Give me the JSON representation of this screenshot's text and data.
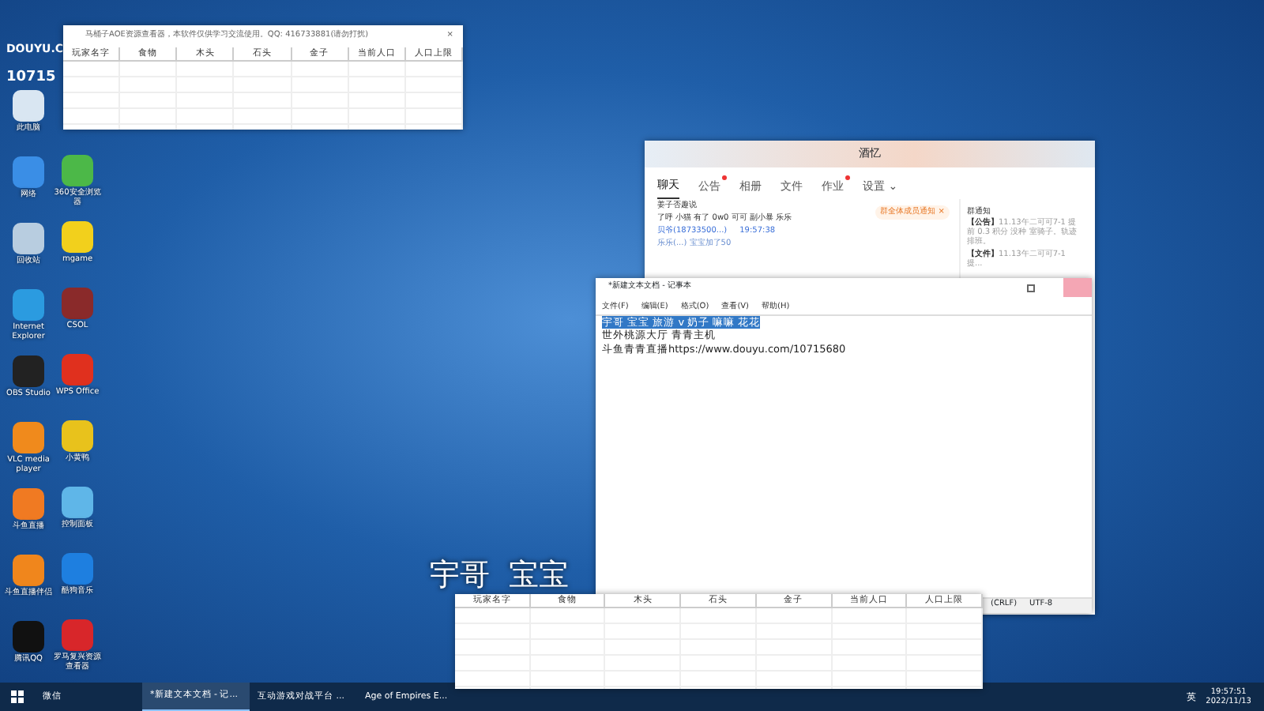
{
  "desktop_icons": {
    "left": [
      {
        "label": "此电脑",
        "color": "#d9e6f2"
      },
      {
        "label": "网络",
        "color": "#3a8ee6"
      },
      {
        "label": "回收站",
        "color": "#b8cde0"
      },
      {
        "label": "Internet Explorer",
        "color": "#2b9be0"
      },
      {
        "label": "OBS Studio",
        "color": "#222222"
      },
      {
        "label": "VLC media player",
        "color": "#f08a1c"
      },
      {
        "label": "斗鱼直播",
        "color": "#f07a22"
      },
      {
        "label": "斗鱼直播伴侣",
        "color": "#f0861c"
      },
      {
        "label": "腾讯QQ",
        "color": "#111111"
      }
    ],
    "right": [
      {
        "label": "360安全浏览器",
        "color": "#4cb848"
      },
      {
        "label": "mgame",
        "color": "#f2d01c"
      },
      {
        "label": "CSOL",
        "color": "#8a2a2a"
      },
      {
        "label": "WPS Office",
        "color": "#e0301e"
      },
      {
        "label": "小黄鸭",
        "color": "#e8c21c"
      },
      {
        "label": "控制面板",
        "color": "#5fb6e8"
      },
      {
        "label": "酷狗音乐",
        "color": "#1e7fe0"
      },
      {
        "label": "罗马复兴资源查看器",
        "color": "#d8262a"
      }
    ]
  },
  "logo": {
    "text": "DOUYU.C",
    "room": "10715"
  },
  "overlay_text": "宇哥  宝宝",
  "resource_windows": [
    {
      "title": "马桶子AOE资源查看器，本软件仅供学习交流使用。QQ: 416733881(请勿打扰)",
      "close": "×",
      "columns": [
        "玩家名字",
        "食物",
        "木头",
        "石头",
        "金子",
        "当前人口",
        "人口上限"
      ]
    },
    {
      "columns": [
        "玩家名字",
        "食物",
        "木头",
        "石头",
        "金子",
        "当前人口",
        "人口上限"
      ]
    }
  ],
  "chat_window": {
    "title": "酒忆",
    "tabs": [
      {
        "label": "聊天",
        "selected": true,
        "notify": false
      },
      {
        "label": "公告",
        "selected": false,
        "notify": true
      },
      {
        "label": "相册",
        "selected": false,
        "notify": false
      },
      {
        "label": "文件",
        "selected": false,
        "notify": false
      },
      {
        "label": "作业",
        "selected": false,
        "notify": true
      },
      {
        "label": "设置 ⌄",
        "selected": false,
        "notify": false
      }
    ],
    "messages": [
      {
        "kind": "text",
        "text": "姜子否趣说"
      },
      {
        "kind": "text",
        "text": "了呼 小猫 有了 0w0 可可 副小暴 乐乐"
      },
      {
        "kind": "sender",
        "text": "贝爷(18733500...)",
        "time": "19:57:38"
      },
      {
        "kind": "system",
        "text": "乐乐(...) 宝宝加了50"
      }
    ],
    "notice_button": "群全体成员通知 ×",
    "side": {
      "title": "群通知",
      "items": [
        {
          "tag": "【公告】",
          "text": "11.13午二可可7-1 提前 0.3 积分 没种 室骑子。轨迹排班。"
        },
        {
          "tag": "【文件】",
          "text": "11.13午二可可7-1 提..."
        }
      ]
    }
  },
  "notepad": {
    "title": "*新建文本文档 - 记事本",
    "menu": [
      "文件(F)",
      "编辑(E)",
      "格式(O)",
      "查看(V)",
      "帮助(H)"
    ],
    "lines": [
      {
        "text": "宇哥 宝宝 旅游 v 奶子 嘛嘛 花花",
        "selected": true
      },
      {
        "text": "世外桃源大厅 青青主机",
        "selected": false
      },
      {
        "text": "斗鱼青青直播https://www.douyu.com/10715680",
        "selected": false
      }
    ],
    "status": [
      "(CRLF)",
      "UTF-8"
    ]
  },
  "taskbar": {
    "items": [
      {
        "label": "微信",
        "active": false
      },
      {
        "label": "*新建文本文档 - 记...",
        "active": true
      },
      {
        "label": "互动游戏对战平台 ...",
        "active": false
      },
      {
        "label": "Age of Empires E...",
        "active": false
      }
    ],
    "ime": "英",
    "time": "19:57:51",
    "date": "2022/11/13"
  }
}
